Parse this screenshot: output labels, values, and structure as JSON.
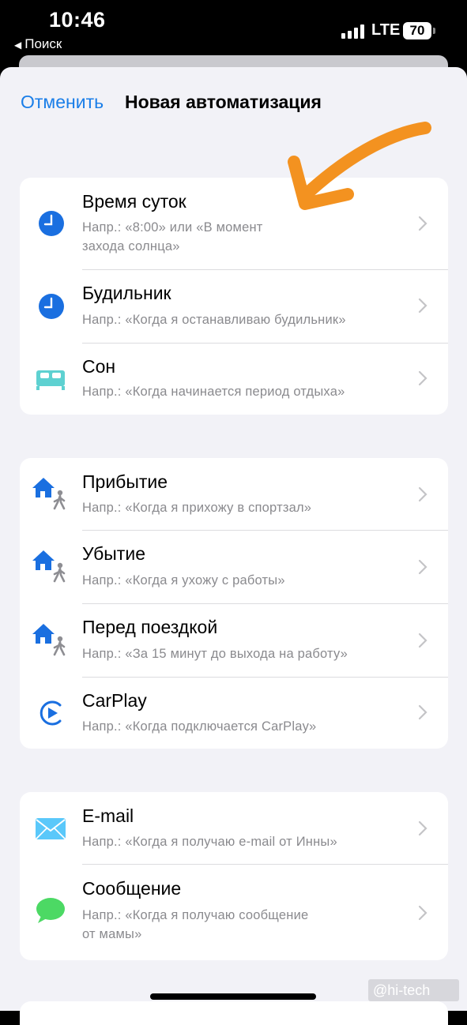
{
  "status_bar": {
    "time": "10:46",
    "back_app": "Поиск",
    "network": "LTE",
    "battery": "70"
  },
  "nav": {
    "cancel_label": "Отменить",
    "title": "Новая автоматизация"
  },
  "groups": [
    {
      "items": [
        {
          "title": "Время суток",
          "subtitle_lines": [
            "Напр.: «8:00» или «В момент",
            "захода солнца»"
          ],
          "icon": "clock-icon"
        },
        {
          "title": "Будильник",
          "subtitle_lines": [
            "Напр.: «Когда я останавливаю будильник»"
          ],
          "icon": "alarm-clock-icon"
        },
        {
          "title": "Сон",
          "subtitle_lines": [
            "Напр.: «Когда начинается период отдыха»"
          ],
          "icon": "bed-icon"
        }
      ]
    },
    {
      "items": [
        {
          "title": "Прибытие",
          "subtitle_lines": [
            "Напр.: «Когда я прихожу в спортзал»"
          ],
          "icon": "home-person-icon"
        },
        {
          "title": "Убытие",
          "subtitle_lines": [
            "Напр.: «Когда я ухожу с работы»"
          ],
          "icon": "home-person-icon"
        },
        {
          "title": "Перед поездкой",
          "subtitle_lines": [
            "Напр.: «За 15 минут до выхода на работу»"
          ],
          "icon": "home-person-icon"
        },
        {
          "title": "CarPlay",
          "subtitle_lines": [
            "Напр.: «Когда подключается CarPlay»"
          ],
          "icon": "carplay-icon"
        }
      ]
    },
    {
      "items": [
        {
          "title": "E-mail",
          "subtitle_lines": [
            "Напр.: «Когда я получаю e-mail от Инны»"
          ],
          "icon": "mail-icon"
        },
        {
          "title": "Сообщение",
          "subtitle_lines": [
            "Напр.: «Когда я получаю сообщение",
            "от мамы»"
          ],
          "icon": "message-bubble-icon"
        }
      ]
    }
  ],
  "watermark": "@hi-tech",
  "colors": {
    "accent": "#1a7ee8",
    "annotation_arrow": "#f39220",
    "sleep_icon": "#5ed1d1",
    "message_icon": "#4cd964"
  }
}
